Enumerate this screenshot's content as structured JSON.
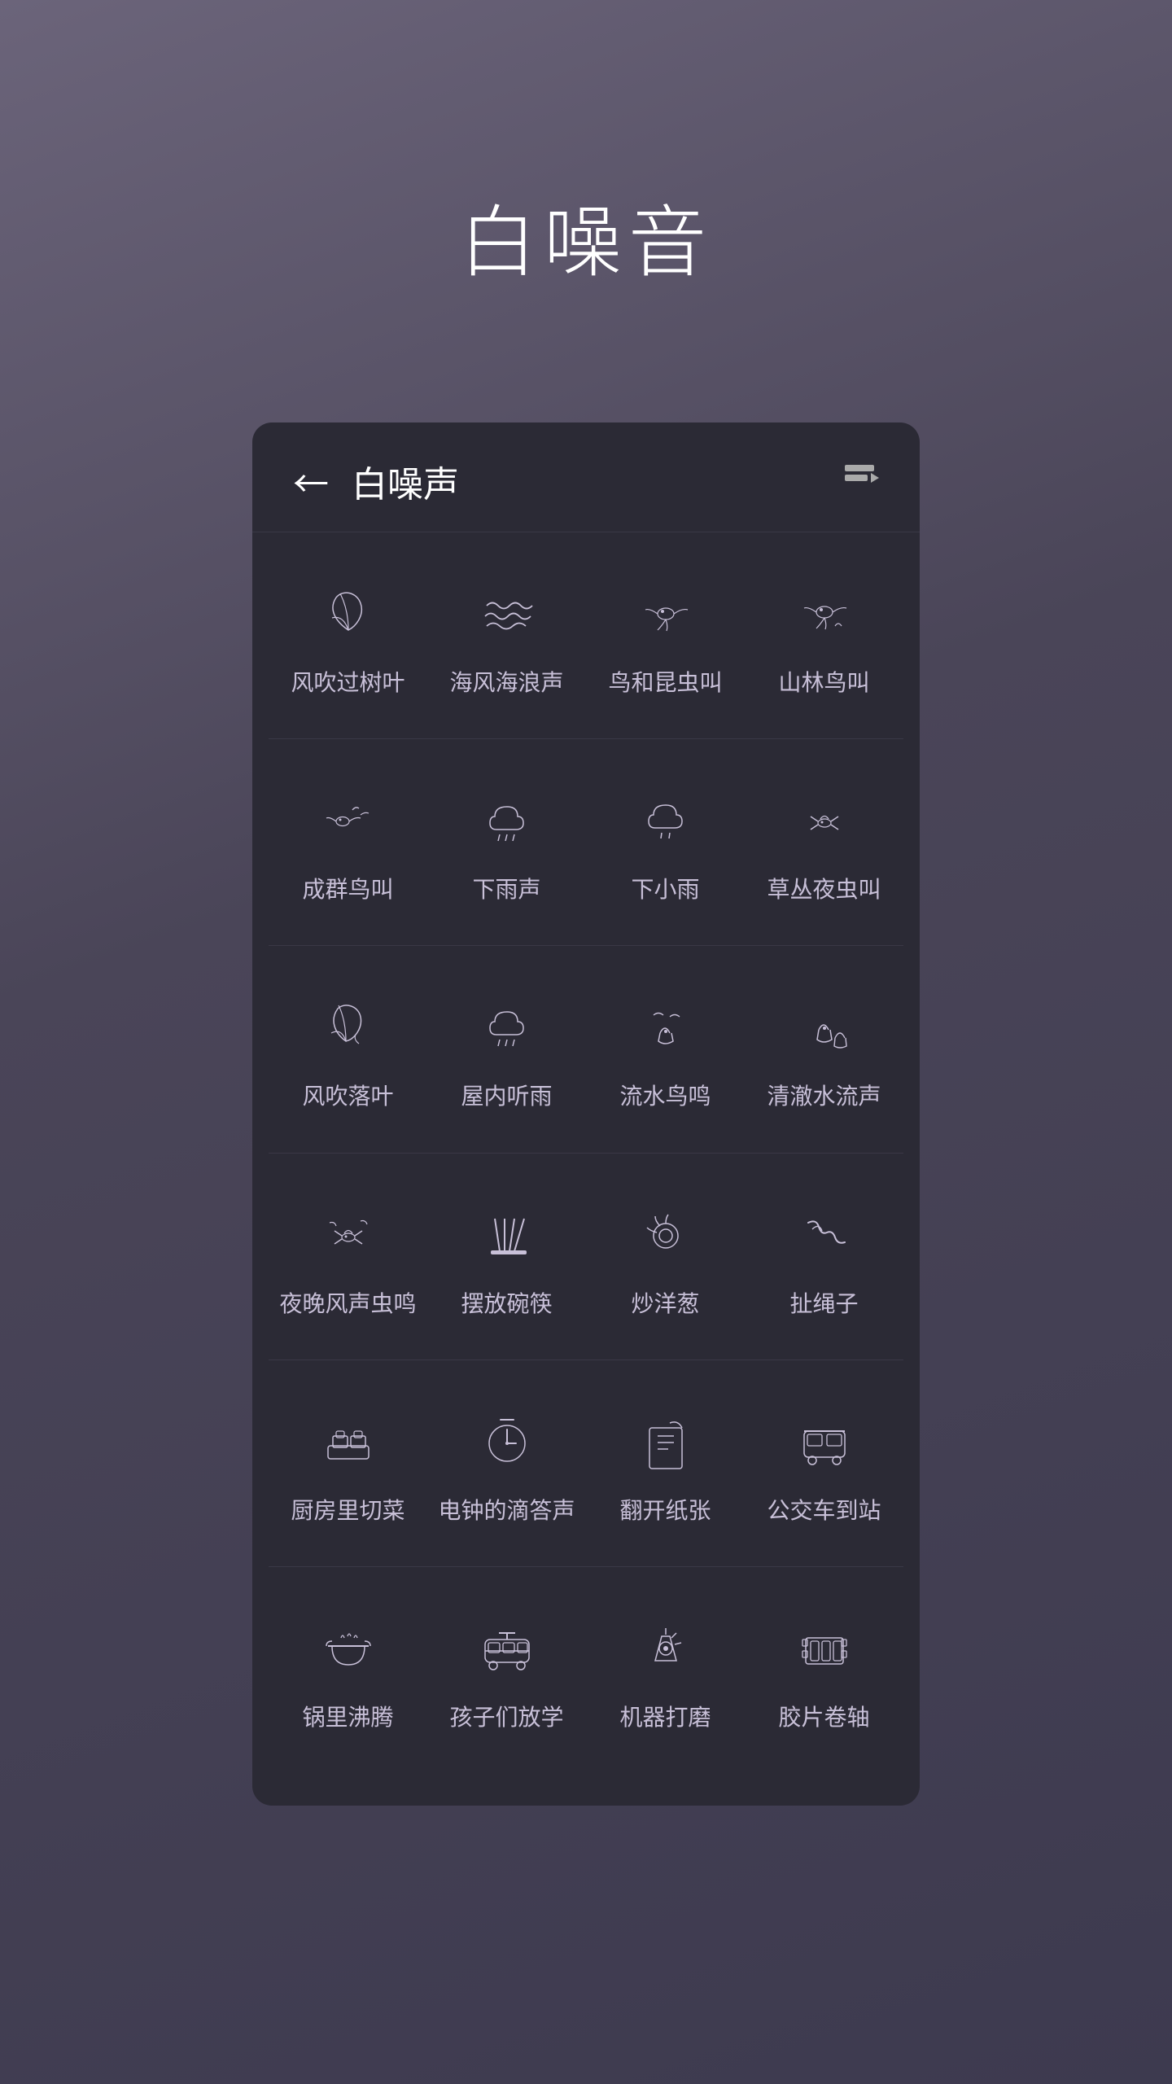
{
  "page": {
    "title": "白噪音",
    "background": "#5a5268"
  },
  "card": {
    "header": {
      "back_label": "←",
      "title": "白噪声",
      "queue_label": "▶"
    },
    "rows": [
      {
        "items": [
          {
            "id": "wind-leaves",
            "label": "风吹过树叶",
            "icon": "leaf"
          },
          {
            "id": "sea-waves",
            "label": "海风海浪声",
            "icon": "waves"
          },
          {
            "id": "birds-insects",
            "label": "鸟和昆虫叫",
            "icon": "bird"
          },
          {
            "id": "mountain-birds",
            "label": "山林鸟叫",
            "icon": "bird2"
          }
        ]
      },
      {
        "items": [
          {
            "id": "flock-birds",
            "label": "成群鸟叫",
            "icon": "bird3"
          },
          {
            "id": "rain",
            "label": "下雨声",
            "icon": "rain"
          },
          {
            "id": "light-rain",
            "label": "下小雨",
            "icon": "rain2"
          },
          {
            "id": "night-insects",
            "label": "草丛夜虫叫",
            "icon": "bug"
          }
        ]
      },
      {
        "items": [
          {
            "id": "falling-leaves",
            "label": "风吹落叶",
            "icon": "leaf2"
          },
          {
            "id": "indoor-rain",
            "label": "屋内听雨",
            "icon": "rain3"
          },
          {
            "id": "stream-birds",
            "label": "流水鸟鸣",
            "icon": "stream"
          },
          {
            "id": "clear-stream",
            "label": "清澈水流声",
            "icon": "stream2"
          }
        ]
      },
      {
        "items": [
          {
            "id": "night-wind-bugs",
            "label": "夜晚风声虫鸣",
            "icon": "bug2"
          },
          {
            "id": "chopsticks",
            "label": "摆放碗筷",
            "icon": "chopsticks"
          },
          {
            "id": "fry-onion",
            "label": "炒洋葱",
            "icon": "wok"
          },
          {
            "id": "jump-rope",
            "label": "扯绳子",
            "icon": "rope"
          }
        ]
      },
      {
        "items": [
          {
            "id": "kitchen-cut",
            "label": "厨房里切菜",
            "icon": "kitchen"
          },
          {
            "id": "clock-tick",
            "label": "电钟的滴答声",
            "icon": "clock"
          },
          {
            "id": "flip-paper",
            "label": "翻开纸张",
            "icon": "paper"
          },
          {
            "id": "bus-stop",
            "label": "公交车到站",
            "icon": "bus"
          }
        ]
      },
      {
        "items": [
          {
            "id": "boiling-pot",
            "label": "锅里沸腾",
            "icon": "pot"
          },
          {
            "id": "school-out",
            "label": "孩子们放学",
            "icon": "school-bus"
          },
          {
            "id": "machine-grind",
            "label": "机器打磨",
            "icon": "grind"
          },
          {
            "id": "film-reel",
            "label": "胶片卷轴",
            "icon": "film"
          }
        ]
      }
    ]
  }
}
